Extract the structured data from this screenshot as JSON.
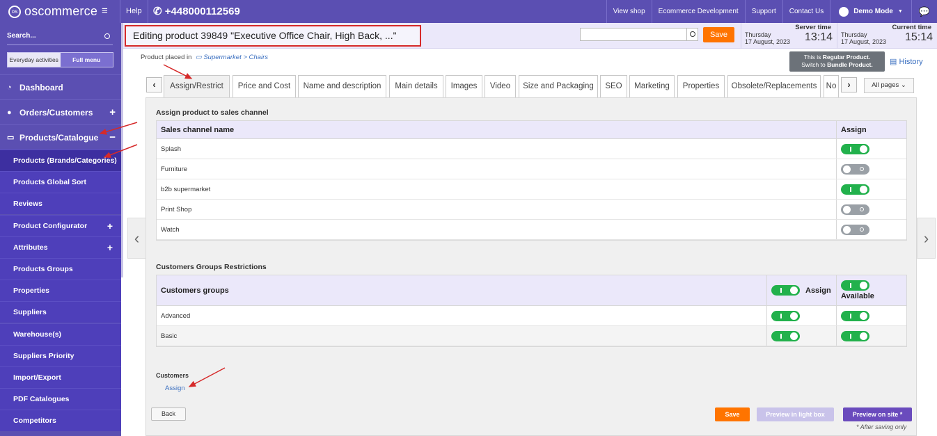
{
  "topbar": {
    "logo": "oscommerce",
    "help": "Help",
    "phone": "+448000112569",
    "links": [
      "View shop",
      "Ecommerce Development",
      "Support",
      "Contact Us"
    ],
    "user": "Demo Mode"
  },
  "sidebar": {
    "search_label": "Search...",
    "toggle": [
      "Everyday activities",
      "Full menu"
    ],
    "top_items": [
      {
        "label": "Dashboard",
        "expander": ""
      },
      {
        "label": "Orders/Customers",
        "expander": "+"
      },
      {
        "label": "Products/Catalogue",
        "expander": "−"
      }
    ],
    "sub_items": [
      {
        "label": "Products (Brands/Categories)",
        "expander": ""
      },
      {
        "label": "Products Global Sort",
        "expander": ""
      },
      {
        "label": "Reviews",
        "expander": ""
      },
      {
        "label": "Product Configurator",
        "expander": "+"
      },
      {
        "label": "Attributes",
        "expander": "+"
      },
      {
        "label": "Products Groups",
        "expander": ""
      },
      {
        "label": "Properties",
        "expander": ""
      },
      {
        "label": "Suppliers",
        "expander": ""
      },
      {
        "label": "Warehouse(s)",
        "expander": ""
      },
      {
        "label": "Suppliers Priority",
        "expander": ""
      },
      {
        "label": "Import/Export",
        "expander": ""
      },
      {
        "label": "PDF Catalogues",
        "expander": ""
      },
      {
        "label": "Competitors",
        "expander": ""
      }
    ]
  },
  "header": {
    "title": "Editing product 39849 \"Executive Office Chair, High Back, ...\"",
    "save_label": "Save",
    "server": {
      "label": "Server time",
      "day": "Thursday",
      "date": "17 August, 2023",
      "time": "13:14"
    },
    "current": {
      "label": "Current time",
      "day": "Thursday",
      "date": "17 August, 2023",
      "time": "15:14"
    }
  },
  "placed": {
    "prefix": "Product placed in",
    "path": "Supermarket > Chairs"
  },
  "product_type": {
    "line1_prefix": "This is ",
    "line1_bold": "Regular Product.",
    "line2_prefix": "Switch to ",
    "line2_bold": "Bundle Product."
  },
  "history_label": "History",
  "tabs": [
    "Assign/Restrict",
    "Price and Cost",
    "Name and description",
    "Main details",
    "Images",
    "Video",
    "Size and Packaging",
    "SEO",
    "Marketing",
    "Properties",
    "Obsolete/Replacements",
    "No"
  ],
  "all_pages": "All pages",
  "sales_channel": {
    "title": "Assign product to sales channel",
    "col_name": "Sales channel name",
    "col_assign": "Assign",
    "rows": [
      {
        "name": "Splash",
        "on": true
      },
      {
        "name": "Furniture",
        "on": false
      },
      {
        "name": "b2b supermarket",
        "on": true
      },
      {
        "name": "Print Shop",
        "on": false
      },
      {
        "name": "Watch",
        "on": false
      }
    ]
  },
  "groups": {
    "title": "Customers Groups Restrictions",
    "col_name": "Customers groups",
    "col_assign": "Assign",
    "col_available": "Available",
    "rows": [
      {
        "name": "Advanced",
        "assign": true,
        "available": true
      },
      {
        "name": "Basic",
        "assign": true,
        "available": true
      }
    ]
  },
  "customers": {
    "title": "Customers",
    "assign_link": "Assign"
  },
  "footer": {
    "back": "Back",
    "save": "Save",
    "preview_lightbox": "Preview in light box",
    "preview_site": "Preview on site *",
    "note": "* After saving only"
  },
  "colors": {
    "brand": "#5b4fb2",
    "accent": "#ff7400",
    "switch_on": "#22b14c",
    "switch_off": "#9aa0a6",
    "annotation": "#d62a2a"
  }
}
